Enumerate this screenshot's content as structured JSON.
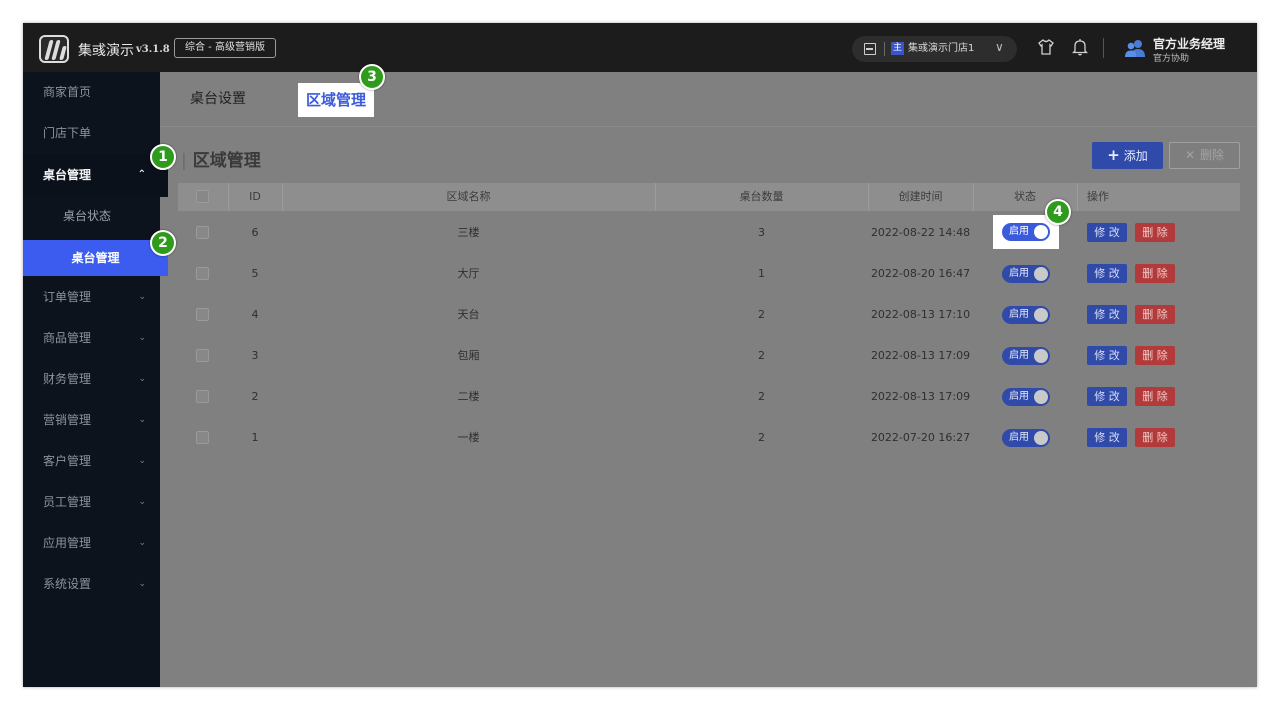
{
  "header": {
    "app_name": "集彧演示",
    "version": "v3.1.8",
    "edition": "综合 - 高级营销版",
    "store": {
      "badge": "主",
      "name": "集彧演示门店1"
    },
    "user": {
      "name": "官方业务经理",
      "role": "官方协助"
    }
  },
  "sidebar": {
    "items_top": [
      {
        "label": "商家首页"
      },
      {
        "label": "门店下单"
      }
    ],
    "group": {
      "label": "桌台管理"
    },
    "sub_items": [
      {
        "label": "桌台状态"
      },
      {
        "label": "桌台管理"
      }
    ],
    "items_bottom": [
      {
        "label": "订单管理"
      },
      {
        "label": "商品管理"
      },
      {
        "label": "财务管理"
      },
      {
        "label": "营销管理"
      },
      {
        "label": "客户管理"
      },
      {
        "label": "员工管理"
      },
      {
        "label": "应用管理"
      },
      {
        "label": "系统设置"
      }
    ]
  },
  "tabs": [
    {
      "label": "桌台设置"
    },
    {
      "label": "区域管理"
    }
  ],
  "section": {
    "title": "区域管理",
    "add_label": "添加",
    "delete_label": "删除"
  },
  "table": {
    "columns": [
      "ID",
      "区域名称",
      "桌台数量",
      "创建时间",
      "状态",
      "操作"
    ],
    "rows": [
      {
        "id": "6",
        "name": "三楼",
        "count": "3",
        "created": "2022-08-22 14:48",
        "status": "启用"
      },
      {
        "id": "5",
        "name": "大厅",
        "count": "1",
        "created": "2022-08-20 16:47",
        "status": "启用"
      },
      {
        "id": "4",
        "name": "天台",
        "count": "2",
        "created": "2022-08-13 17:10",
        "status": "启用"
      },
      {
        "id": "3",
        "name": "包厢",
        "count": "2",
        "created": "2022-08-13 17:09",
        "status": "启用"
      },
      {
        "id": "2",
        "name": "二楼",
        "count": "2",
        "created": "2022-08-13 17:09",
        "status": "启用"
      },
      {
        "id": "1",
        "name": "一楼",
        "count": "2",
        "created": "2022-07-20 16:27",
        "status": "启用"
      }
    ],
    "edit_label": "修 改",
    "remove_label": "删 除"
  },
  "step_badges": [
    "1",
    "2",
    "3",
    "4"
  ],
  "colors": {
    "accent": "#3c5cf0",
    "badge_green": "#2e9b1c",
    "danger": "#b23a3a"
  }
}
